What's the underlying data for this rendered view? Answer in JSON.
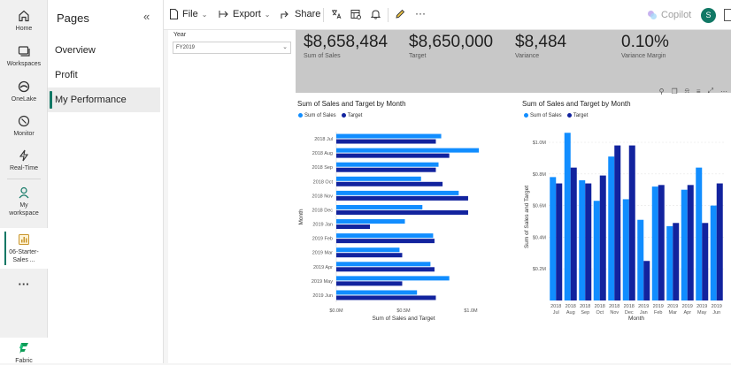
{
  "rail": {
    "items": [
      {
        "label": "Home",
        "icon": "home-icon"
      },
      {
        "label": "Workspaces",
        "icon": "workspaces-icon"
      },
      {
        "label": "OneLake",
        "icon": "onelake-icon"
      },
      {
        "label": "Monitor",
        "icon": "monitor-icon"
      },
      {
        "label": "Real-Time",
        "icon": "realtime-icon"
      },
      {
        "label": "My workspace",
        "icon": "person-icon"
      },
      {
        "label": "06-Starter-Sales ...",
        "icon": "report-icon"
      }
    ],
    "more": "···",
    "fabric_label": "Fabric"
  },
  "pages": {
    "title": "Pages",
    "collapse": "«",
    "items": [
      "Overview",
      "Profit",
      "My Performance"
    ],
    "active_index": 2
  },
  "toolbar": {
    "file": "File",
    "export": "Export",
    "share": "Share",
    "copilot": "Copilot",
    "more": "···",
    "user_initial": "S"
  },
  "slicer": {
    "title": "Year",
    "value": "FY2019"
  },
  "kpis": [
    {
      "value": "$8,658,484",
      "label": "Sum of Sales"
    },
    {
      "value": "$8,650,000",
      "label": "Target"
    },
    {
      "value": "$8,484",
      "label": "Variance"
    },
    {
      "value": "0.10%",
      "label": "Variance Margin"
    }
  ],
  "colors": {
    "sales": "#118dff",
    "target": "#12239e",
    "accent": "#117865"
  },
  "chart_data": [
    {
      "type": "bar",
      "orientation": "horizontal",
      "title": "Sum of Sales and Target by Month",
      "xlabel": "Sum of Sales and Target",
      "ylabel": "Month",
      "categories": [
        "2018 Jul",
        "2018 Aug",
        "2018 Sep",
        "2018 Oct",
        "2018 Nov",
        "2018 Dec",
        "2019 Jan",
        "2019 Feb",
        "2019 Mar",
        "2019 Apr",
        "2019 May",
        "2019 Jun"
      ],
      "series": [
        {
          "name": "Sum of Sales",
          "values": [
            0.78,
            1.06,
            0.76,
            0.63,
            0.91,
            0.64,
            0.51,
            0.72,
            0.47,
            0.7,
            0.84,
            0.6
          ]
        },
        {
          "name": "Target",
          "values": [
            0.74,
            0.84,
            0.74,
            0.79,
            0.98,
            0.98,
            0.25,
            0.73,
            0.49,
            0.73,
            0.49,
            0.74
          ]
        }
      ],
      "xlim": [
        0,
        1.0
      ],
      "xticks": [
        "$0.0M",
        "$0.5M",
        "$1.0M"
      ],
      "legend": "top-left"
    },
    {
      "type": "bar",
      "orientation": "vertical",
      "title": "Sum of Sales and Target by Month",
      "xlabel": "Month",
      "ylabel": "Sum of Sales and Target",
      "categories": [
        "2018 Jul",
        "2018 Aug",
        "2018 Sep",
        "2018 Oct",
        "2018 Nov",
        "2018 Dec",
        "2019 Jan",
        "2019 Feb",
        "2019 Mar",
        "2019 Apr",
        "2019 May",
        "2019 Jun"
      ],
      "series": [
        {
          "name": "Sum of Sales",
          "values": [
            0.78,
            1.06,
            0.76,
            0.63,
            0.91,
            0.64,
            0.51,
            0.72,
            0.47,
            0.7,
            0.84,
            0.6
          ]
        },
        {
          "name": "Target",
          "values": [
            0.74,
            0.84,
            0.74,
            0.79,
            0.98,
            0.98,
            0.25,
            0.73,
            0.49,
            0.73,
            0.49,
            0.74
          ]
        }
      ],
      "ylim": [
        0,
        1.0
      ],
      "yticks": [
        "$0.2M",
        "$0.4M",
        "$0.6M",
        "$0.8M",
        "$1.0M"
      ],
      "legend": "top-left"
    }
  ]
}
